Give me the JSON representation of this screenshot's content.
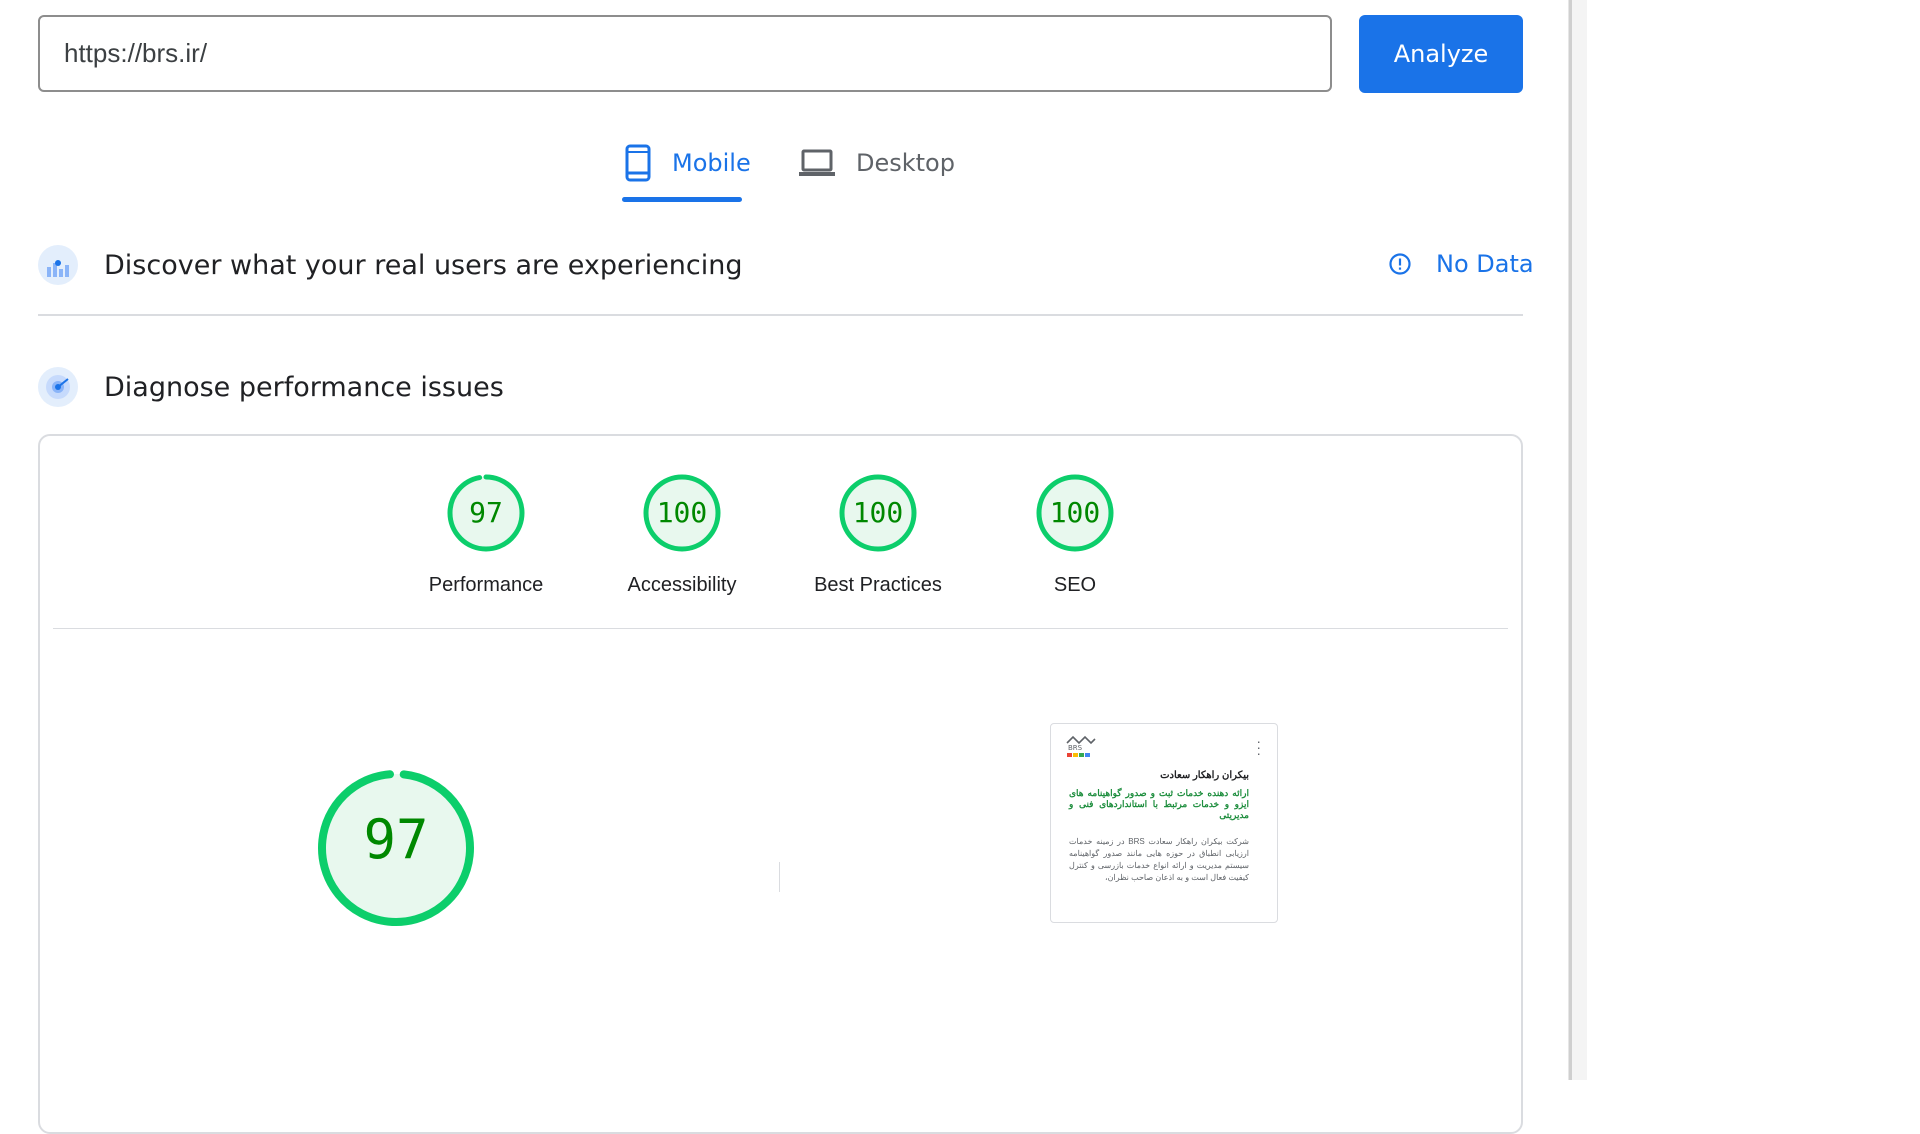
{
  "search": {
    "url_value": "https://brs.ir/",
    "analyze_label": "Analyze"
  },
  "tabs": [
    {
      "label": "Mobile",
      "active": true,
      "icon": "smartphone-icon"
    },
    {
      "label": "Desktop",
      "active": false,
      "icon": "laptop-icon"
    }
  ],
  "real_users": {
    "title": "Discover what your real users are experiencing",
    "status_label": "No Data",
    "status_icon": "info-icon"
  },
  "diagnose": {
    "title": "Diagnose performance issues"
  },
  "scores": [
    {
      "label": "Performance",
      "value": "97",
      "fraction": 0.97
    },
    {
      "label": "Accessibility",
      "value": "100",
      "fraction": 1.0
    },
    {
      "label": "Best Practices",
      "value": "100",
      "fraction": 1.0
    },
    {
      "label": "SEO",
      "value": "100",
      "fraction": 1.0
    }
  ],
  "performance_detail": {
    "score": "97",
    "fraction": 0.97
  },
  "preview": {
    "logo_text": "BRS",
    "site_title": "بیکران راهکار سعادت",
    "subtitle": "ارائه دهنده خدمات ثبت و صدور گواهینامه های ایزو و خدمات مرتبط با استانداردهای فنی و مدیریتی",
    "body": "شرکت بیکران راهکار سعادت BRS در زمینه خدمات ارزیابی انطباق در حوزه هایی مانند صدور گواهینامه سیستم مدیریت و ارائه انواع خدمات بازرسی و کنترل کیفیت فعال است و به اذعان صاحب نظران،"
  },
  "colors": {
    "accent": "#1a73e8",
    "pass": "#0cce6b",
    "pass_text": "#008800",
    "pass_fill": "#e8f8ee"
  }
}
